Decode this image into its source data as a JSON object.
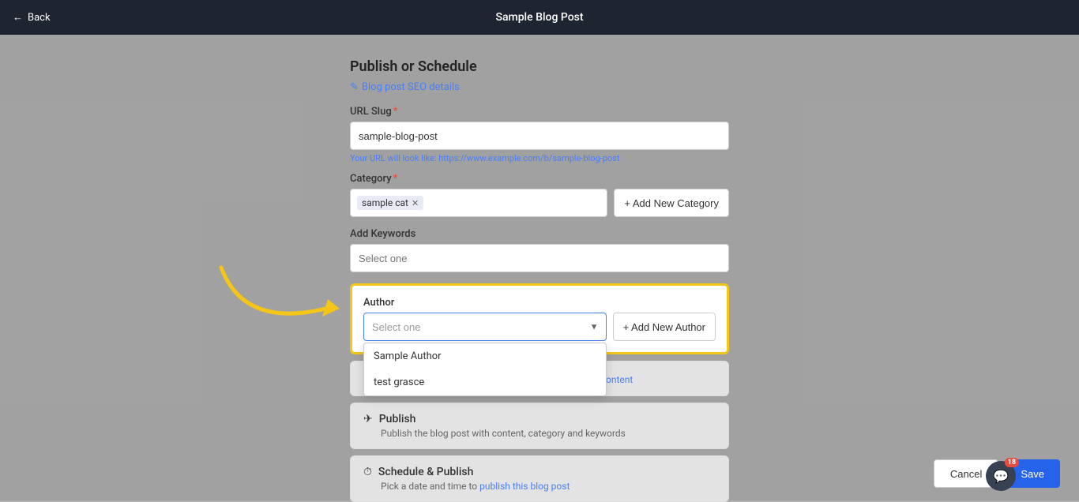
{
  "topBar": {
    "title": "Sample Blog Post",
    "backLabel": "Back"
  },
  "form": {
    "sectionTitle": "Publish or Schedule",
    "seoLink": "Blog post SEO details",
    "urlSlugLabel": "URL Slug",
    "urlSlugValue": "sample-blog-post",
    "urlHintPrefix": "Your URL will look like: ",
    "urlHintValue": "https://www.example.com/b/sample-blog-post",
    "categoryLabel": "Category",
    "categoryTag": "sample cat",
    "addCategoryLabel": "+ Add New Category",
    "keywordsLabel": "Add Keywords",
    "keywordsPlaceholder": "Select one",
    "authorLabel": "Author",
    "authorPlaceholder": "Select one",
    "addAuthorLabel": "+ Add New Author",
    "authorOptions": [
      {
        "value": "sample-author",
        "label": "Sample Author"
      },
      {
        "value": "test-grasce",
        "label": "test grasce"
      }
    ]
  },
  "actionCards": [
    {
      "id": "save-version",
      "linkText": "Keep saving the version of blog post content"
    },
    {
      "id": "publish",
      "icon": "publish-icon",
      "iconSymbol": "✈",
      "title": "Publish",
      "description": "Publish the blog post with content, category and keywords"
    },
    {
      "id": "schedule-publish",
      "icon": "clock-icon",
      "iconSymbol": "⏱",
      "title": "Schedule & Publish",
      "description": "Pick a date and time to publish this blog post",
      "descriptionLink": "publish this blog post"
    }
  ],
  "buttons": {
    "cancel": "Cancel",
    "save": "Save"
  },
  "chatWidget": {
    "badge": "18"
  }
}
